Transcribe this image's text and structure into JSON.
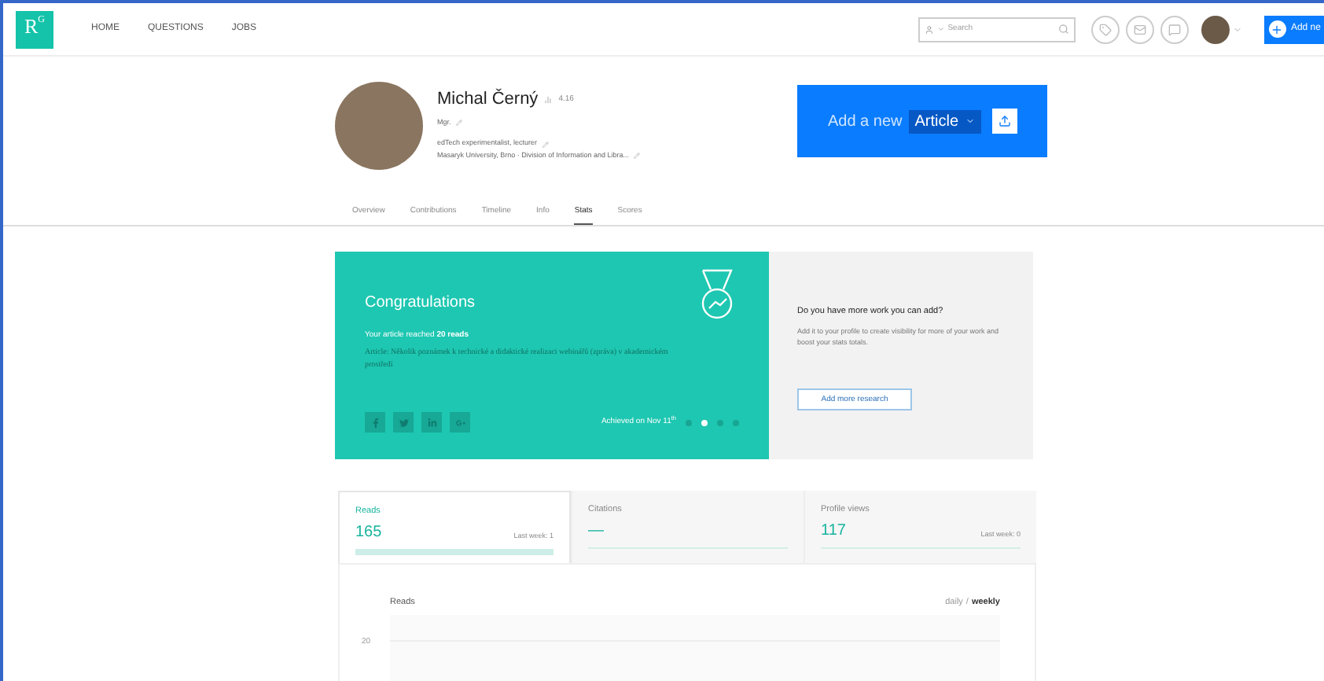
{
  "header": {
    "logo": "R",
    "logo_sup": "G",
    "nav": [
      "HOME",
      "QUESTIONS",
      "JOBS"
    ],
    "search": {
      "placeholder": "Search"
    },
    "add_button": "Add ne"
  },
  "profile": {
    "name": "Michal Černý",
    "score": "4.16",
    "degree": "Mgr.",
    "position": "edTech experimentalist, lecturer",
    "institution": "Masaryk University, Brno · Division of Information and Libra..."
  },
  "add_new": {
    "label": "Add a new",
    "type": "Article"
  },
  "tabs": [
    {
      "label": "Overview",
      "selected": false
    },
    {
      "label": "Contributions",
      "selected": false
    },
    {
      "label": "Timeline",
      "selected": false
    },
    {
      "label": "Info",
      "selected": false
    },
    {
      "label": "Stats",
      "selected": true
    },
    {
      "label": "Scores",
      "selected": false
    }
  ],
  "milestone": {
    "title": "Congratulations",
    "message": "Your article reached **20 reads**",
    "article": "Article: Několik poznámek k technické a didaktické realizaci webinářů (zpráva) v akademickém prostředí",
    "achieved": "Achieved on Nov 11$^{th}$",
    "slides": [
      {
        "selected": false
      },
      {
        "selected": true
      },
      {
        "selected": false
      },
      {
        "selected": false
      }
    ]
  },
  "more_work": {
    "title": "Do you have more work you can add?",
    "text": "Add it to your profile to create visibility for more of your work and boost your stats totals.",
    "button": "Add more research"
  },
  "stat_tabs": [
    {
      "label": "Reads",
      "value": "165",
      "last_week": "Last week: 1",
      "selected": true
    },
    {
      "label": "Citations",
      "value": "—",
      "selected": false
    },
    {
      "label": "Profile views",
      "value": "117",
      "last_week": "Last week: 0",
      "selected": false
    }
  ],
  "chart": {
    "title": "Reads",
    "periods": [
      {
        "label": "daily",
        "selected": false
      },
      {
        "label": "weekly",
        "selected": true
      }
    ],
    "separator": "/",
    "y_tick": "20"
  }
}
